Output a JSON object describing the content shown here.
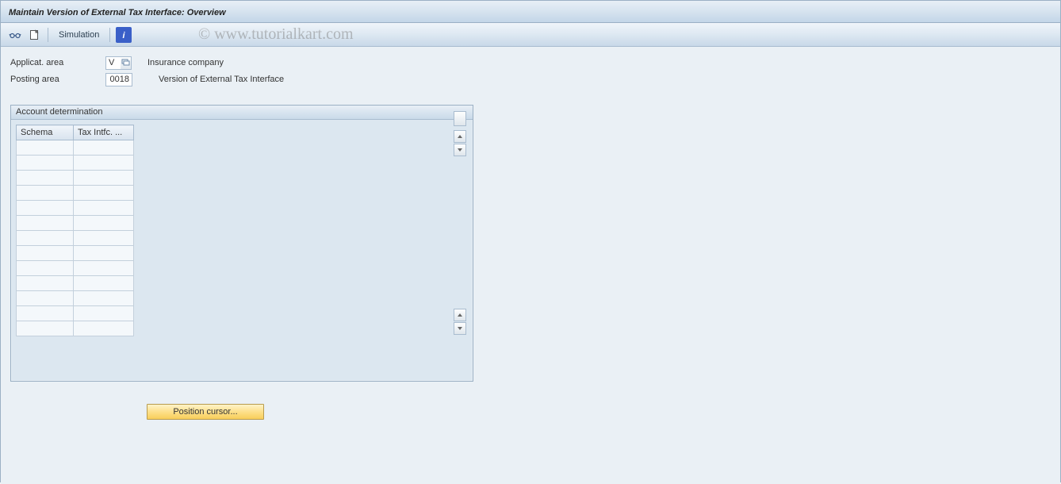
{
  "window": {
    "title": "Maintain Version of External Tax Interface: Overview"
  },
  "toolbar": {
    "simulation_label": "Simulation"
  },
  "fields": {
    "applicat_area": {
      "label": "Applicat. area",
      "value": "V",
      "desc": "Insurance company"
    },
    "posting_area": {
      "label": "Posting area",
      "value": "0018",
      "desc": "Version of External Tax Interface"
    }
  },
  "panel": {
    "title": "Account determination",
    "columns": {
      "schema": "Schema",
      "tax": "Tax Intfc. ..."
    },
    "rows": [
      {
        "schema": "",
        "tax": ""
      },
      {
        "schema": "",
        "tax": ""
      },
      {
        "schema": "",
        "tax": ""
      },
      {
        "schema": "",
        "tax": ""
      },
      {
        "schema": "",
        "tax": ""
      },
      {
        "schema": "",
        "tax": ""
      },
      {
        "schema": "",
        "tax": ""
      },
      {
        "schema": "",
        "tax": ""
      },
      {
        "schema": "",
        "tax": ""
      },
      {
        "schema": "",
        "tax": ""
      },
      {
        "schema": "",
        "tax": ""
      },
      {
        "schema": "",
        "tax": ""
      },
      {
        "schema": "",
        "tax": ""
      }
    ]
  },
  "buttons": {
    "position_cursor": "Position cursor..."
  },
  "watermark": "© www.tutorialkart.com"
}
